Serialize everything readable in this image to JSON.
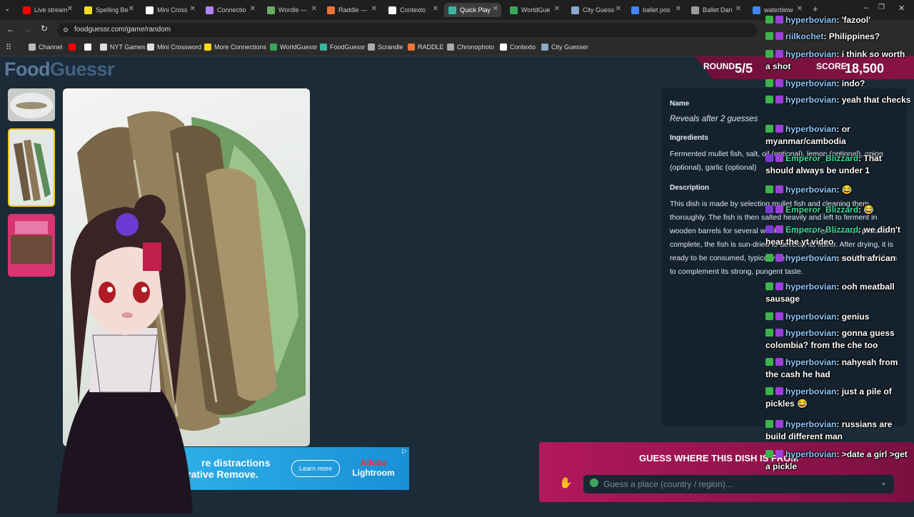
{
  "browser": {
    "tabs": [
      {
        "label": "Live stream",
        "icon": "youtube-icon",
        "color": "#ff0000"
      },
      {
        "label": "Spelling Be",
        "icon": "spelling-bee-icon",
        "color": "#f7da21"
      },
      {
        "label": "Mini Cross",
        "icon": "nyt-icon",
        "color": "#ffffff"
      },
      {
        "label": "Connectio",
        "icon": "connections-icon",
        "color": "#b084f5"
      },
      {
        "label": "Wordle —",
        "icon": "wordle-icon",
        "color": "#6aaa64"
      },
      {
        "label": "Raddle —",
        "icon": "raddle-icon",
        "color": "#e8763a"
      },
      {
        "label": "Contexto",
        "icon": "contexto-icon",
        "color": "#ffffff"
      },
      {
        "label": "Quick Play",
        "icon": "foodguessr-icon",
        "color": "#3ab5a0"
      },
      {
        "label": "WorldGue",
        "icon": "worldguessr-icon",
        "color": "#3ca55c"
      },
      {
        "label": "City Guess",
        "icon": "globe-icon",
        "color": "#8aa8c8"
      },
      {
        "label": "ballet pos",
        "icon": "google-icon",
        "color": "#4285f4"
      },
      {
        "label": "Ballet Dan",
        "icon": "ballet-icon",
        "color": "#9c9c9c"
      },
      {
        "label": "waterblow",
        "icon": "google-icon",
        "color": "#4285f4"
      }
    ],
    "url": "foodguessr.com/game/random",
    "bookmarks": [
      {
        "label": "Channel",
        "icon": "folder-icon",
        "color": "#bbbbbb"
      },
      {
        "label": "",
        "icon": "youtube-icon",
        "color": "#ff0000"
      },
      {
        "label": "",
        "icon": "x-icon",
        "color": "#ffffff"
      },
      {
        "label": "NYT Games",
        "icon": "nyt-icon",
        "color": "#dddddd"
      },
      {
        "label": "Mini Crossword",
        "icon": "nyt-icon",
        "color": "#dddddd"
      },
      {
        "label": "More Connections",
        "icon": "grid-icon",
        "color": "#f7da21"
      },
      {
        "label": "WorldGuessr",
        "icon": "worldguessr-icon",
        "color": "#3ca55c"
      },
      {
        "label": "FoodGuessr",
        "icon": "foodguessr-icon",
        "color": "#3ab5a0"
      },
      {
        "label": "Scrandle",
        "icon": "scrandle-icon",
        "color": "#aaaaaa"
      },
      {
        "label": "RADDLE",
        "icon": "raddle-icon",
        "color": "#e8763a"
      },
      {
        "label": "Chronophoto",
        "icon": "camera-icon",
        "color": "#aaaaaa"
      },
      {
        "label": "Contexto",
        "icon": "contexto-icon",
        "color": "#ffffff"
      },
      {
        "label": "City Guesser",
        "icon": "globe-icon",
        "color": "#8aa8c8"
      }
    ]
  },
  "game": {
    "logo_part1": "Food",
    "logo_part2": "Guessr",
    "round_label": "ROUND",
    "round_value": "5/5",
    "score_label": "SCORE",
    "score_value": "18,500",
    "name_label": "Name",
    "name_value": "Reveals after 2 guesses",
    "ingredients_label": "Ingredients",
    "ingredients_value": "Fermented mullet fish, salt, oil (optional), lemon (optional), onion (optional), garlic (optional)",
    "description_label": "Description",
    "description_value": "This dish is made by selecting mullet fish and cleaning them thoroughly. The fish is then salted heavily and left to ferment in wooden barrels for several weeks. Once the fermentation process is complete, the fish is sun-dried to develop its flavor. After drying, it is ready to be consumed, typically served with onions and lemon slices to complement its strong, pungent taste.",
    "guess_title": "GUESS WHERE THIS DISH IS FROM",
    "guess_placeholder": "Guess a place (country / region)..."
  },
  "ad": {
    "text_line1": "re distractions",
    "text_line2": "enerative Remove.",
    "button": "Learn more",
    "brand1": "Adobe",
    "brand2": "Lightroom"
  },
  "chat": [
    {
      "user": "hyperbovian",
      "text": "'fazool'"
    },
    {
      "user": "riilkochet",
      "text": "Philippines?"
    },
    {
      "user": "hyperbovian",
      "text": "i think so worth a shot"
    },
    {
      "user": "hyperbovian",
      "text": "indo?"
    },
    {
      "user": "hyperbovian",
      "text": "yeah that checks"
    },
    {
      "user": "hyperbovian",
      "text": "or myanmar/cambodia"
    },
    {
      "user": "Emperor_Blizzard",
      "text": "That should always be under 1"
    },
    {
      "user": "hyperbovian",
      "text": "😂"
    },
    {
      "user": "Emperor_Blizzard",
      "text": "😂"
    },
    {
      "user": "Emperor_Blizzard",
      "text": "we didn't hear the yt video"
    },
    {
      "user": "hyperbovian",
      "text": "south african"
    },
    {
      "user": "hyperbovian",
      "text": "ooh meatball sausage"
    },
    {
      "user": "hyperbovian",
      "text": "genius"
    },
    {
      "user": "hyperbovian",
      "text": "gonna guess colombia? from the che too"
    },
    {
      "user": "hyperbovian",
      "text": "nahyeah from the cash he had"
    },
    {
      "user": "hyperbovian",
      "text": "just a pile of pickles 😂"
    },
    {
      "user": "hyperbovian",
      "text": "russians are build different man"
    },
    {
      "user": "hyperbovian",
      "text": ">date a girl >get a pickle"
    }
  ]
}
